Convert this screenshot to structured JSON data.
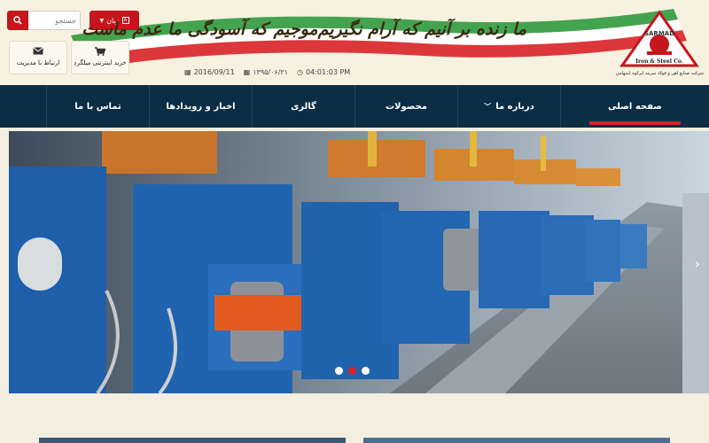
{
  "header": {
    "search": {
      "placeholder": "جستجو"
    },
    "language": {
      "label": "زبان"
    },
    "quick_links": [
      {
        "label": "خرید اینترنتی میلگرد",
        "icon": "cart-icon"
      },
      {
        "label": "ارتباط با مدیریت",
        "icon": "envelope-icon"
      }
    ],
    "slogan": {
      "right": "ما زنده بر آنیم که آرام نگیریم",
      "left": "موجیم که آسودگی ما عدم ماست"
    },
    "dates": {
      "gregorian": "2016/09/11",
      "jalali": "۱۳۹۵/۰۶/۲۱",
      "time": "04:01:03 PM"
    },
    "logo": {
      "top_text": "SARMAD",
      "bottom_text": "Iron & Steel Co.",
      "caption": "شرکت صنایع آهن و فولاد سرمد ابرکوه (سهامی خاص)"
    },
    "colors": {
      "accent": "#c4161c",
      "nav_bg": "#0b2e45"
    }
  },
  "nav": {
    "items": [
      {
        "label": "صفحه اصلی",
        "active": true
      },
      {
        "label": "درباره ما",
        "dropdown": true
      },
      {
        "label": "محصولات"
      },
      {
        "label": "گالری"
      },
      {
        "label": "اخبار و رویدادها"
      },
      {
        "label": "تماس با ما"
      }
    ]
  },
  "slider": {
    "slide_count": 3,
    "active_slide": 2
  }
}
